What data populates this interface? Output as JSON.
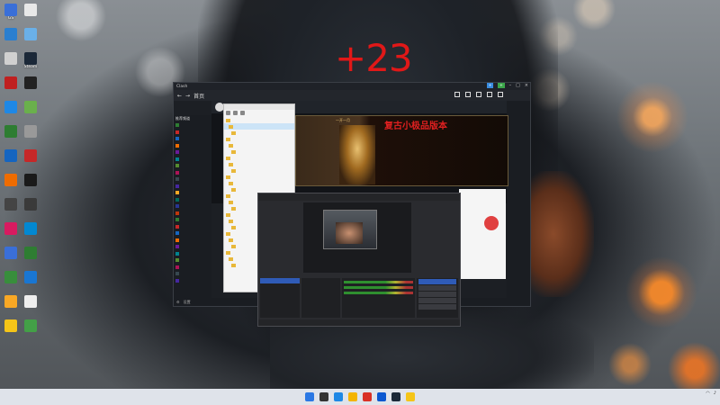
{
  "overlay_text": "+23",
  "desktop_icons": [
    {
      "name": "app-icon-1",
      "label": "GS",
      "color": "#3a6fd8"
    },
    {
      "name": "app-icon-2",
      "label": "",
      "color": "#e8e8e8"
    },
    {
      "name": "app-icon-3",
      "label": "",
      "color": "#2a7fd0"
    },
    {
      "name": "app-icon-4",
      "label": "",
      "color": "#6ab0e8"
    },
    {
      "name": "app-icon-5",
      "label": "",
      "color": "#d0d0d0"
    },
    {
      "name": "app-icon-6",
      "label": "Steam",
      "color": "#1b2838"
    },
    {
      "name": "app-icon-7",
      "label": "",
      "color": "#c02020"
    },
    {
      "name": "app-icon-8",
      "label": "",
      "color": "#222222"
    },
    {
      "name": "app-icon-9",
      "label": "",
      "color": "#1e88e5"
    },
    {
      "name": "app-icon-10",
      "label": "",
      "color": "#6ab04c"
    },
    {
      "name": "app-icon-11",
      "label": "",
      "color": "#2e7d32"
    },
    {
      "name": "app-icon-12",
      "label": "",
      "color": "#999999"
    },
    {
      "name": "app-icon-13",
      "label": "",
      "color": "#1565c0"
    },
    {
      "name": "app-icon-14",
      "label": "",
      "color": "#c62828"
    },
    {
      "name": "app-icon-15",
      "label": "",
      "color": "#ef6c00"
    },
    {
      "name": "app-icon-16",
      "label": "",
      "color": "#1a1a1a"
    },
    {
      "name": "app-icon-17",
      "label": "",
      "color": "#444444"
    },
    {
      "name": "app-icon-18",
      "label": "",
      "color": "#3a3a3a"
    },
    {
      "name": "app-icon-19",
      "label": "",
      "color": "#d81b60"
    },
    {
      "name": "app-icon-20",
      "label": "",
      "color": "#0288d1"
    },
    {
      "name": "app-icon-21",
      "label": "",
      "color": "#3a6fd8"
    },
    {
      "name": "app-icon-22",
      "label": "",
      "color": "#2e7d32"
    },
    {
      "name": "app-icon-23",
      "label": "",
      "color": "#388e3c"
    },
    {
      "name": "app-icon-24",
      "label": "",
      "color": "#1976d2"
    },
    {
      "name": "app-icon-25",
      "label": "",
      "color": "#f9a825"
    },
    {
      "name": "app-icon-26",
      "label": "",
      "color": "#eeeeee"
    },
    {
      "name": "app-icon-27",
      "label": "",
      "color": "#f5c518"
    },
    {
      "name": "app-icon-28",
      "label": "",
      "color": "#43a047"
    }
  ],
  "main_window": {
    "title": "Clash",
    "page_title": "首页",
    "section_label": "推荐频道",
    "buttons": [
      "+",
      "+"
    ],
    "bottom_label": "设置"
  },
  "sidebar_colors": [
    "#2e7d32",
    "#c62828",
    "#1565c0",
    "#ef6c00",
    "#6a1b9a",
    "#00838f",
    "#558b2f",
    "#ad1457",
    "#37474f",
    "#4527a0",
    "#f9a825",
    "#00695c",
    "#283593",
    "#bf360c",
    "#2e7d32",
    "#c62828",
    "#1565c0",
    "#ef6c00",
    "#6a1b9a",
    "#00838f",
    "#558b2f",
    "#ad1457",
    "#37474f",
    "#4527a0"
  ],
  "banner": {
    "title": "复古小极品版本",
    "subtitle": "一开一月",
    "lines": [
      "",
      "",
      "",
      "",
      "",
      "",
      "",
      ""
    ]
  },
  "taskbar_icons": [
    "#2b78e4",
    "#333333",
    "#1e88e5",
    "#f4b400",
    "#d93025",
    "#0b57d0",
    "#1b2838",
    "#f5c518"
  ]
}
